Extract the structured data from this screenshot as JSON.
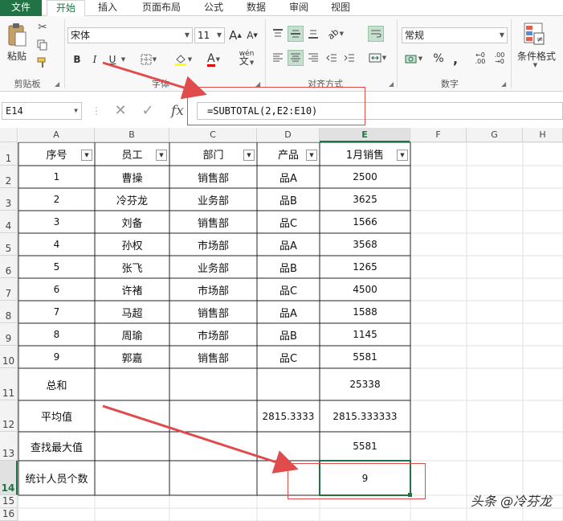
{
  "tabs": [
    "文件",
    "开始",
    "插入",
    "页面布局",
    "公式",
    "数据",
    "审阅",
    "视图"
  ],
  "ribbon": {
    "paste_label": "粘贴",
    "clipboard_label": "剪贴板",
    "font_name": "宋体",
    "font_size": "11",
    "font_group_label": "字体",
    "align_group_label": "对齐方式",
    "number_format": "常规",
    "number_group_label": "数字",
    "cond_format_label": "条件格式",
    "bold": "B",
    "italic": "I",
    "underline": "U",
    "grow_font": "A",
    "shrink_font": "A",
    "font_color_letter": "A",
    "phonetic": "wén",
    "percent": "%",
    "comma": ","
  },
  "formula_bar": {
    "name_box": "E14",
    "formula": "=SUBTOTAL(2,E2:E10)",
    "fx": "fx"
  },
  "columns": [
    "A",
    "B",
    "C",
    "D",
    "E",
    "F",
    "G",
    "H"
  ],
  "rows": [
    "1",
    "2",
    "3",
    "4",
    "5",
    "6",
    "7",
    "8",
    "9",
    "10",
    "11",
    "12",
    "13",
    "14",
    "15",
    "16"
  ],
  "headers": [
    "序号",
    "员工",
    "部门",
    "产品",
    "1月销售"
  ],
  "data_rows": [
    [
      "1",
      "曹操",
      "销售部",
      "品A",
      "2500"
    ],
    [
      "2",
      "冷芬龙",
      "业务部",
      "品B",
      "3625"
    ],
    [
      "3",
      "刘备",
      "销售部",
      "品C",
      "1566"
    ],
    [
      "4",
      "孙权",
      "市场部",
      "品A",
      "3568"
    ],
    [
      "5",
      "张飞",
      "业务部",
      "品B",
      "1265"
    ],
    [
      "6",
      "许褚",
      "市场部",
      "品C",
      "4500"
    ],
    [
      "7",
      "马超",
      "销售部",
      "品A",
      "1588"
    ],
    [
      "8",
      "周瑜",
      "市场部",
      "品B",
      "1145"
    ],
    [
      "9",
      "郭嘉",
      "销售部",
      "品C",
      "5581"
    ]
  ],
  "summary": {
    "sum_label": "总和",
    "sum_value": "25338",
    "avg_label": "平均值",
    "avg_d": "2815.3333",
    "avg_e": "2815.333333",
    "max_label": "查找最大值",
    "max_value": "5581",
    "count_label": "统计人员个数",
    "count_value": "9"
  },
  "watermark": "头条 @冷芬龙",
  "colors": {
    "accent": "#217346",
    "annotation": "#e04b4b"
  }
}
